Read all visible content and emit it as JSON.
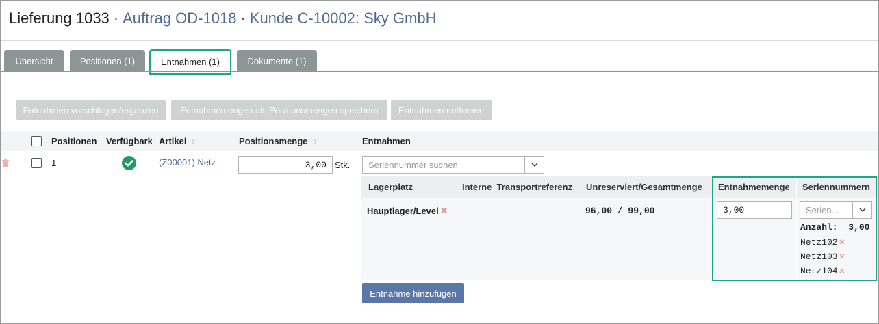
{
  "header": {
    "delivery": "Lieferung 1033",
    "separator": "·",
    "order_link": "Auftrag OD-1018",
    "customer_link": "Kunde C-10002: Sky GmbH"
  },
  "tabs": [
    {
      "label": "Übersicht"
    },
    {
      "label": "Positionen (1)"
    },
    {
      "label": "Entnahmen (1)"
    },
    {
      "label": "Dokumente (1)"
    }
  ],
  "toolbar": {
    "suggest_label": "Entnahmen vorschlagen/ergänzen",
    "save_qty_label": "Entnahmemengen als Positionsmengen speichern",
    "remove_label": "Entnahmen entfernen"
  },
  "table": {
    "headers": {
      "positions": "Positionen",
      "availability": "Verfügbark",
      "article": "Artikel",
      "position_qty": "Positionsmenge",
      "withdrawals": "Entnahmen"
    },
    "row": {
      "position": "1",
      "article": "(Z00001) Netz",
      "qty_value": "3,00",
      "unit": "Stk.",
      "serial_search_placeholder": "Seriennummer suchen"
    }
  },
  "withdrawal_table": {
    "headers": {
      "storage": "Lagerplatz",
      "transport_ref": "Interne  Transportreferenz",
      "unreserved_total": "Unreserviert/Gesamtmenge",
      "withdrawal_qty": "Entnahmemenge",
      "serial_numbers": "Seriennummern"
    },
    "row": {
      "storage": "Hauptlager/Level",
      "unreserved_total": "96,00 / 99,00",
      "withdrawal_qty": "3,00",
      "serial_select_placeholder": "Serien...",
      "count_label": "Anzahl:",
      "count_value": "3,00",
      "serials": [
        "Netz102",
        "Netz103",
        "Netz104"
      ]
    }
  },
  "add_button_label": "Entnahme hinzufügen",
  "colors": {
    "accent_teal": "#1fa38a",
    "link_blue": "#4f6a95",
    "primary_button": "#5a77a8",
    "tab_gray": "#8e9597",
    "success_green": "#1e9e62",
    "remove_red": "#e88c8c"
  }
}
